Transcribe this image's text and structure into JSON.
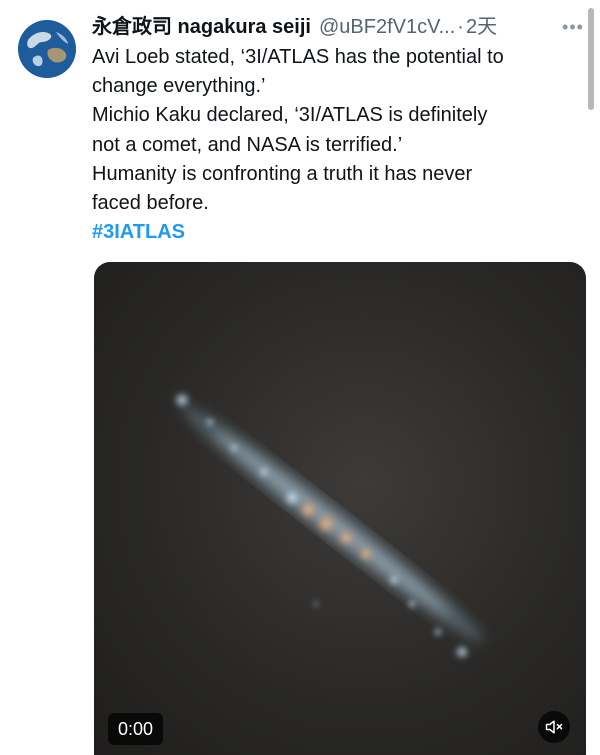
{
  "tweet": {
    "author": {
      "display_name": "永倉政司 nagakura seiji",
      "handle": "@uBF2fV1cV...",
      "separator": "·",
      "time": "2天"
    },
    "more_icon": "more-horizontal-icon",
    "text_lines": [
      "Avi Loeb stated, ‘3I/ATLAS has the potential to",
      "change everything.’",
      "Michio Kaku declared, ‘3I/ATLAS is definitely",
      "not a comet, and NASA is terrified.’",
      "Humanity is confronting a truth it has never",
      "faced before."
    ],
    "hashtag": "#3IATLAS",
    "media": {
      "type": "video",
      "timecode": "0:00",
      "mute_icon": "volume-muted-icon"
    }
  },
  "colors": {
    "hashtag": "#1d9bf0",
    "secondary_text": "#536471",
    "primary_text": "#0f1419"
  }
}
